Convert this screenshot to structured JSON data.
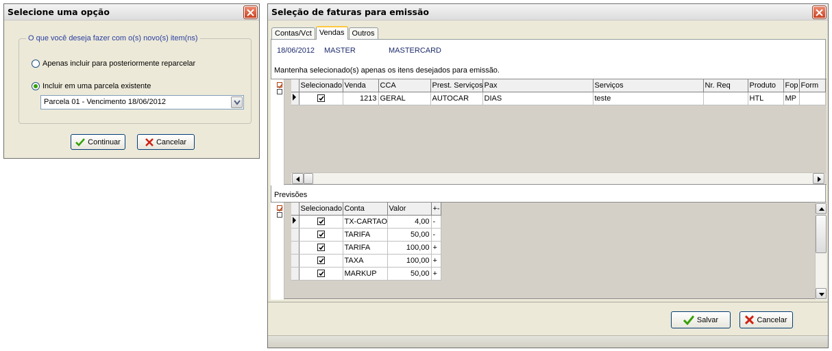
{
  "dialog1": {
    "title": "Selecione uma opção",
    "group_label": "O que você deseja fazer com o(s) novo(s) item(ns)",
    "option1": "Apenas incluir para posteriormente reparcelar",
    "option2": "Incluir em uma parcela existente",
    "selected_option": "option2",
    "combo_value": "Parcela 01 - Vencimento 18/06/2012",
    "continue_label": "Continuar",
    "cancel_label": "Cancelar"
  },
  "main": {
    "title": "Seleção de faturas para emissão",
    "tabs": [
      {
        "label": "Contas/Vct",
        "active": false
      },
      {
        "label": "Vendas",
        "active": true
      },
      {
        "label": "Outros",
        "active": false
      }
    ],
    "info": {
      "date": "18/06/2012",
      "name1": "MASTER",
      "name2": "MASTERCARD"
    },
    "instruction": "Mantenha selecionado(s) apenas os itens desejados para emissão.",
    "vendas_grid": {
      "columns": [
        "Selecionado",
        "Venda",
        "CCA",
        "Prest. Serviços",
        "Pax",
        "Serviços",
        "Nr. Req",
        "Produto",
        "Fop",
        "Form"
      ],
      "rows": [
        {
          "selecionado": true,
          "venda": "1213",
          "cca": "GERAL",
          "prest": "AUTOCAR",
          "pax": "DIAS",
          "servicos": "teste",
          "nr_req": "",
          "produto": "HTL",
          "fop": "MP",
          "form": ""
        }
      ]
    },
    "previsoes_label": "Previsões",
    "previsoes_grid": {
      "columns": [
        "Selecionado",
        "Conta",
        "Valor",
        "+-"
      ],
      "rows": [
        {
          "selecionado": true,
          "conta": "TX-CARTAO",
          "valor": "4,00",
          "sign": "-"
        },
        {
          "selecionado": true,
          "conta": "TARIFA",
          "valor": "50,00",
          "sign": "-"
        },
        {
          "selecionado": true,
          "conta": "TARIFA",
          "valor": "100,00",
          "sign": "+"
        },
        {
          "selecionado": true,
          "conta": "TAXA",
          "valor": "100,00",
          "sign": "+"
        },
        {
          "selecionado": true,
          "conta": "MARKUP",
          "valor": "50,00",
          "sign": "+"
        }
      ]
    },
    "save_label": "Salvar",
    "cancel_label": "Cancelar"
  },
  "colors": {
    "accent_blue": "#2a3fa0",
    "close_red": "#c9411f",
    "check_green": "#35a000",
    "cancel_red": "#d02010"
  }
}
